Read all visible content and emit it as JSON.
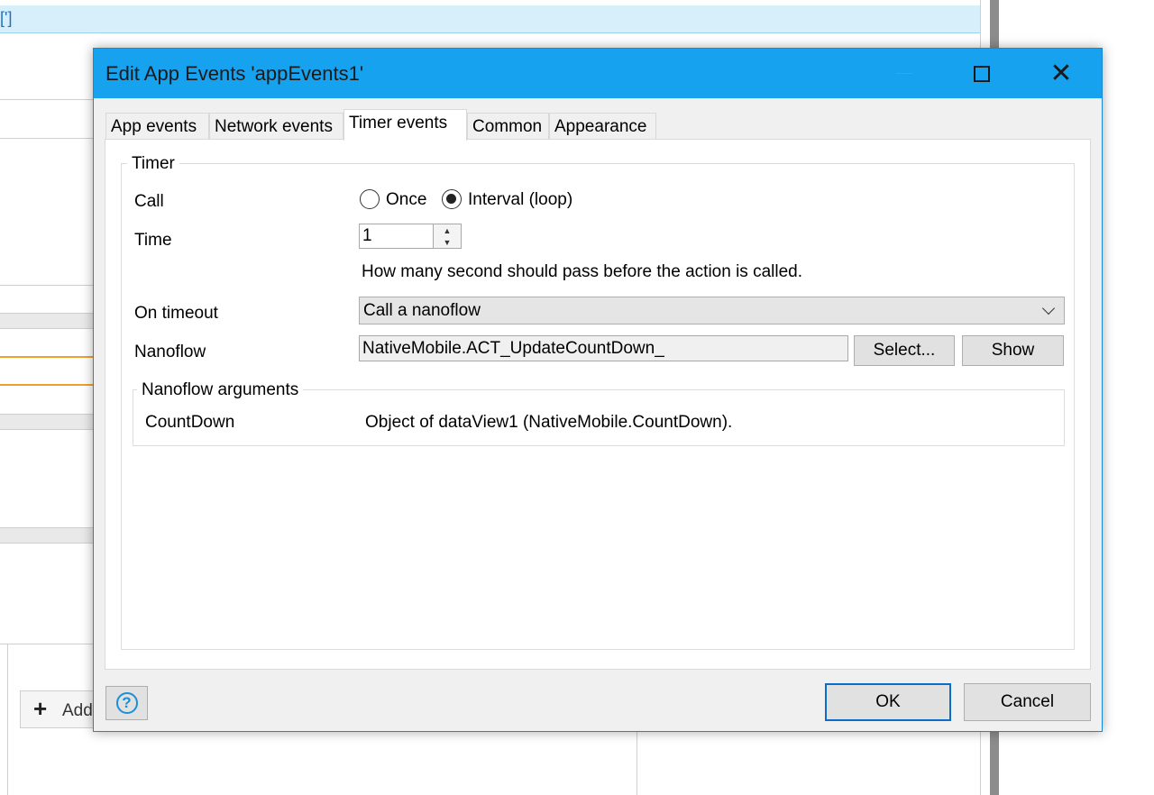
{
  "background": {
    "topbar_text": "[']",
    "add_button_label": "Add"
  },
  "dialog": {
    "title": "Edit App Events 'appEvents1'",
    "window_controls": {
      "minimize": "minimize-icon",
      "maximize": "maximize-icon",
      "close": "close-icon"
    },
    "tabs": [
      {
        "label": "App events",
        "active": false
      },
      {
        "label": "Network events",
        "active": false
      },
      {
        "label": "Timer events",
        "active": true
      },
      {
        "label": "Common",
        "active": false
      },
      {
        "label": "Appearance",
        "active": false
      }
    ],
    "timer": {
      "group_label": "Timer",
      "call_label": "Call",
      "call_options": [
        {
          "label": "Once",
          "selected": false
        },
        {
          "label": "Interval (loop)",
          "selected": true
        }
      ],
      "time_label": "Time",
      "time_value": "1",
      "time_hint": "How many second should pass before the action is called.",
      "on_timeout_label": "On timeout",
      "on_timeout_value": "Call a nanoflow",
      "nanoflow_label": "Nanoflow",
      "nanoflow_value": "NativeMobile.ACT_UpdateCountDown_",
      "select_button": "Select...",
      "show_button": "Show"
    },
    "arguments": {
      "group_label": "Nanoflow arguments",
      "rows": [
        {
          "name": "CountDown",
          "value": "Object of dataView1 (NativeMobile.CountDown)."
        }
      ]
    },
    "footer": {
      "help_icon": "help-icon",
      "ok_label": "OK",
      "cancel_label": "Cancel"
    }
  }
}
